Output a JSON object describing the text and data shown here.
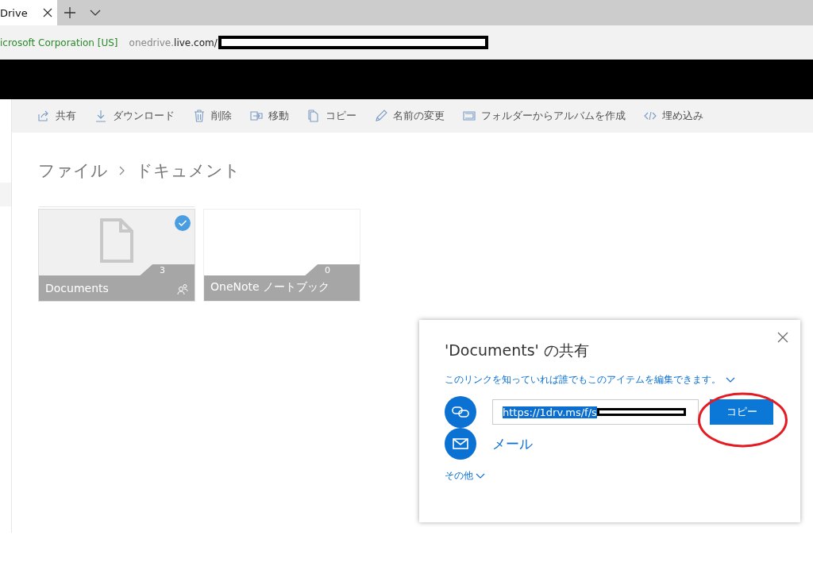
{
  "browser": {
    "tab_title": "Drive",
    "address": {
      "identity": "icrosoft Corporation [US]",
      "host_prefix": "onedrive.",
      "host": "live.com/"
    }
  },
  "toolbar": [
    {
      "label": "共有"
    },
    {
      "label": "ダウンロード"
    },
    {
      "label": "削除"
    },
    {
      "label": "移動"
    },
    {
      "label": "コピー"
    },
    {
      "label": "名前の変更"
    },
    {
      "label": "フォルダーからアルバムを作成"
    },
    {
      "label": "埋め込み"
    }
  ],
  "breadcrumb": [
    "ファイル",
    "ドキュメント"
  ],
  "tiles": [
    {
      "name": "Documents",
      "count": "3",
      "selected": true,
      "shared": true,
      "kind": "folder"
    },
    {
      "name": "OneNote ノートブック",
      "count": "0",
      "selected": false,
      "shared": false,
      "kind": "empty"
    }
  ],
  "share_dialog": {
    "title": "'Documents' の共有",
    "permission": "このリンクを知っていれば誰でもこのアイテムを編集できます。",
    "link": "https://1drv.ms/f/s",
    "copy_button": "コピー",
    "mail": "メール",
    "more": "その他"
  }
}
